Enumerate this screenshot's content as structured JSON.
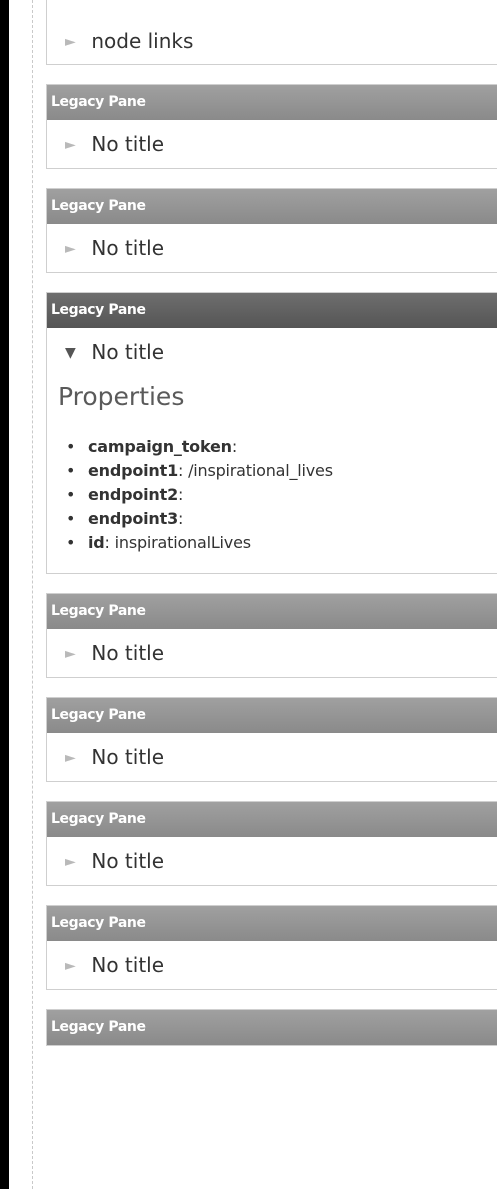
{
  "panes": [
    {
      "header": "",
      "title": "node links",
      "expanded": false
    },
    {
      "header": "Legacy Pane",
      "title": "No title",
      "expanded": false
    },
    {
      "header": "Legacy Pane",
      "title": "No title",
      "expanded": false
    },
    {
      "header": "Legacy Pane",
      "title": "No title",
      "expanded": true,
      "properties_heading": "Properties",
      "properties": [
        {
          "key": "campaign_token",
          "sep": ":",
          "value": ""
        },
        {
          "key": "endpoint1",
          "sep": ":",
          "value": " /inspirational_lives"
        },
        {
          "key": "endpoint2",
          "sep": ":",
          "value": ""
        },
        {
          "key": "endpoint3",
          "sep": ":",
          "value": ""
        },
        {
          "key": "id",
          "sep": ":",
          "value": " inspirationalLives"
        }
      ]
    },
    {
      "header": "Legacy Pane",
      "title": "No title",
      "expanded": false
    },
    {
      "header": "Legacy Pane",
      "title": "No title",
      "expanded": false
    },
    {
      "header": "Legacy Pane",
      "title": "No title",
      "expanded": false
    },
    {
      "header": "Legacy Pane",
      "title": "No title",
      "expanded": false
    },
    {
      "header": "Legacy Pane",
      "title": "",
      "expanded": false
    }
  ],
  "icons": {
    "collapsed": "triangle-right-icon",
    "expanded": "triangle-down-icon"
  },
  "colors": {
    "header_bg": "#8f8f8f",
    "header_active_bg": "#5f5f5f",
    "border": "#cfcfcf",
    "text": "#333333"
  }
}
